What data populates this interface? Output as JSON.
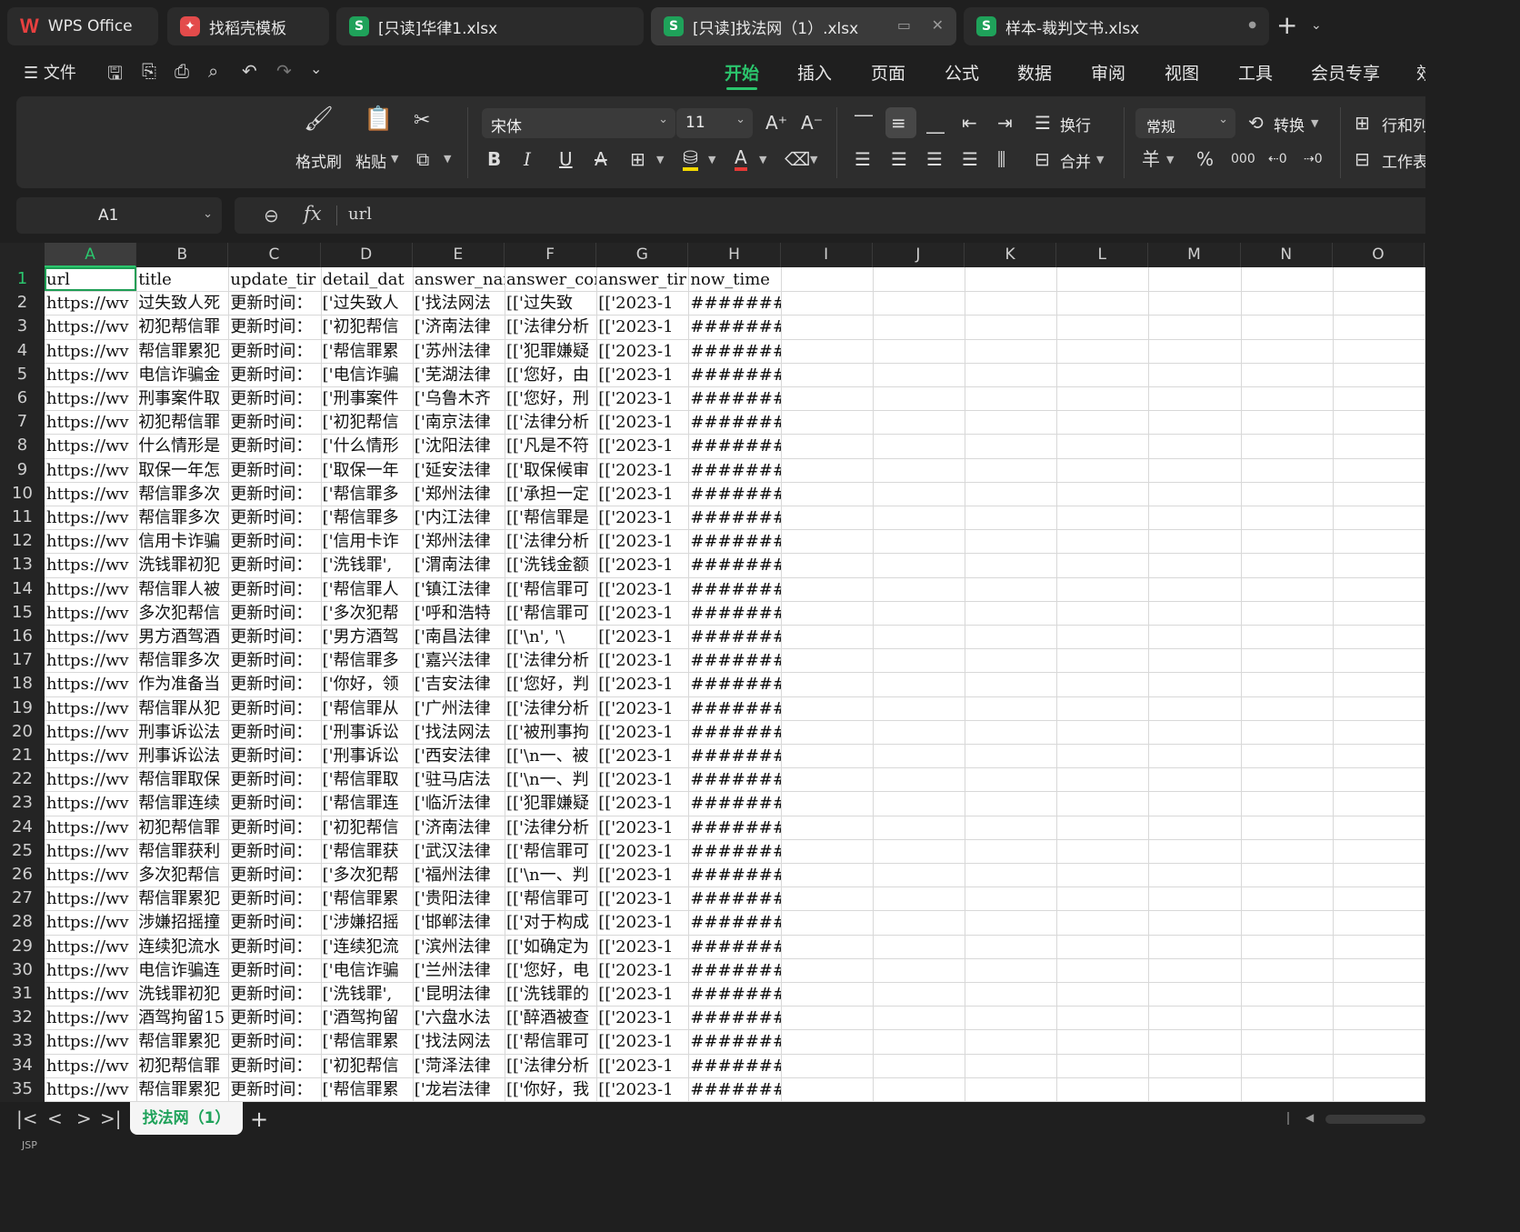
{
  "tabs": [
    {
      "label": "WPS Office",
      "icon": "wps-logo-icon"
    },
    {
      "label": "找稻壳模板",
      "icon": "docer-icon"
    },
    {
      "label": "[只读]华律1.xlsx",
      "icon": "sheet-file-icon"
    },
    {
      "label": "[只读]找法网（1）.xlsx",
      "icon": "sheet-file-icon",
      "active": true
    },
    {
      "label": "样本-裁判文书.xlsx",
      "icon": "sheet-file-icon"
    }
  ],
  "menu": {
    "file": "文件",
    "tabs": [
      "开始",
      "插入",
      "页面",
      "公式",
      "数据",
      "审阅",
      "视图",
      "工具",
      "会员专享",
      "效"
    ],
    "active_tab": "开始"
  },
  "ribbon": {
    "format_painter": "格式刷",
    "paste": "粘贴",
    "font_name": "宋体",
    "font_size": "11",
    "wrap": "换行",
    "merge": "合并",
    "number_format": "常规",
    "convert": "转换",
    "row_col": "行和列",
    "worksheet": "工作表",
    "currency_symbol": "羊",
    "percent_symbol": "%",
    "thousands_symbol": "000"
  },
  "formula_bar": {
    "name_box": "A1",
    "fx": "fx",
    "value": "url"
  },
  "columns": [
    "A",
    "B",
    "C",
    "D",
    "E",
    "F",
    "G",
    "H",
    "I",
    "J",
    "K",
    "L",
    "M",
    "N",
    "O"
  ],
  "selected_column": "A",
  "rows": [
    [
      "url",
      "title",
      "update_tir",
      "detail_dat",
      "answer_nar",
      "answer_cor",
      "answer_tir",
      "now_time"
    ],
    [
      "https://wv",
      "过失致人死",
      "更新时间：",
      "['过失致人",
      "['找法网法",
      "[['过失致",
      "[['2023-1",
      "#########"
    ],
    [
      "https://wv",
      "初犯帮信罪",
      "更新时间：",
      "['初犯帮信",
      "['济南法律",
      "[['法律分析",
      "[['2023-1",
      "#########"
    ],
    [
      "https://wv",
      "帮信罪累犯",
      "更新时间：",
      "['帮信罪累",
      "['苏州法律",
      "[['犯罪嫌疑",
      "[['2023-1",
      "#########"
    ],
    [
      "https://wv",
      "电信诈骗金",
      "更新时间：",
      "['电信诈骗",
      "['芜湖法律",
      "[['您好，由",
      "[['2023-1",
      "#########"
    ],
    [
      "https://wv",
      "刑事案件取",
      "更新时间：",
      "['刑事案件",
      "['乌鲁木齐",
      "[['您好，刑",
      "[['2023-1",
      "#########"
    ],
    [
      "https://wv",
      "初犯帮信罪",
      "更新时间：",
      "['初犯帮信",
      "['南京法律",
      "[['法律分析",
      "[['2023-1",
      "#########"
    ],
    [
      "https://wv",
      "什么情形是",
      "更新时间：",
      "['什么情形",
      "['沈阳法律",
      "[['凡是不符",
      "[['2023-1",
      "#########"
    ],
    [
      "https://wv",
      "取保一年怎",
      "更新时间：",
      "['取保一年",
      "['延安法律",
      "[['取保候审",
      "[['2023-1",
      "#########"
    ],
    [
      "https://wv",
      "帮信罪多次",
      "更新时间：",
      "['帮信罪多",
      "['郑州法律",
      "[['承担一定",
      "[['2023-1",
      "#########"
    ],
    [
      "https://wv",
      "帮信罪多次",
      "更新时间：",
      "['帮信罪多",
      "['内江法律",
      "[['帮信罪是",
      "[['2023-1",
      "#########"
    ],
    [
      "https://wv",
      "信用卡诈骗",
      "更新时间：",
      "['信用卡诈",
      "['郑州法律",
      "[['法律分析",
      "[['2023-1",
      "#########"
    ],
    [
      "https://wv",
      "洗钱罪初犯",
      "更新时间：",
      "['洗钱罪',",
      "['渭南法律",
      "[['洗钱金额",
      "[['2023-1",
      "#########"
    ],
    [
      "https://wv",
      "帮信罪人被",
      "更新时间：",
      "['帮信罪人",
      "['镇江法律",
      "[['帮信罪可",
      "[['2023-1",
      "#########"
    ],
    [
      "https://wv",
      "多次犯帮信",
      "更新时间：",
      "['多次犯帮",
      "['呼和浩特",
      "[['帮信罪可",
      "[['2023-1",
      "#########"
    ],
    [
      "https://wv",
      "男方酒驾酒",
      "更新时间：",
      "['男方酒驾",
      "['南昌法律",
      "[['\\n', '\\",
      "[['2023-1",
      "#########"
    ],
    [
      "https://wv",
      "帮信罪多次",
      "更新时间：",
      "['帮信罪多",
      "['嘉兴法律",
      "[['法律分析",
      "[['2023-1",
      "#########"
    ],
    [
      "https://wv",
      "作为准备当",
      "更新时间：",
      "['你好，领",
      "['吉安法律",
      "[['您好，判",
      "[['2023-1",
      "#########"
    ],
    [
      "https://wv",
      "帮信罪从犯",
      "更新时间：",
      "['帮信罪从",
      "['广州法律",
      "[['法律分析",
      "[['2023-1",
      "#########"
    ],
    [
      "https://wv",
      "刑事诉讼法",
      "更新时间：",
      "['刑事诉讼",
      "['找法网法",
      "[['被刑事拘",
      "[['2023-1",
      "#########"
    ],
    [
      "https://wv",
      "刑事诉讼法",
      "更新时间：",
      "['刑事诉讼",
      "['西安法律",
      "[['\\n一、被",
      "[['2023-1",
      "#########"
    ],
    [
      "https://wv",
      "帮信罪取保",
      "更新时间：",
      "['帮信罪取",
      "['驻马店法",
      "[['\\n一、判",
      "[['2023-1",
      "#########"
    ],
    [
      "https://wv",
      "帮信罪连续",
      "更新时间：",
      "['帮信罪连",
      "['临沂法律",
      "[['犯罪嫌疑",
      "[['2023-1",
      "#########"
    ],
    [
      "https://wv",
      "初犯帮信罪",
      "更新时间：",
      "['初犯帮信",
      "['济南法律",
      "[['法律分析",
      "[['2023-1",
      "#########"
    ],
    [
      "https://wv",
      "帮信罪获利",
      "更新时间：",
      "['帮信罪获",
      "['武汉法律",
      "[['帮信罪可",
      "[['2023-1",
      "#########"
    ],
    [
      "https://wv",
      "多次犯帮信",
      "更新时间：",
      "['多次犯帮",
      "['福州法律",
      "[['\\n一、判",
      "[['2023-1",
      "#########"
    ],
    [
      "https://wv",
      "帮信罪累犯",
      "更新时间：",
      "['帮信罪累",
      "['贵阳法律",
      "[['帮信罪可",
      "[['2023-1",
      "#########"
    ],
    [
      "https://wv",
      "涉嫌招摇撞",
      "更新时间：",
      "['涉嫌招摇",
      "['邯郸法律",
      "[['对于构成",
      "[['2023-1",
      "#########"
    ],
    [
      "https://wv",
      "连续犯流水",
      "更新时间：",
      "['连续犯流",
      "['滨州法律",
      "[['如确定为",
      "[['2023-1",
      "#########"
    ],
    [
      "https://wv",
      "电信诈骗连",
      "更新时间：",
      "['电信诈骗",
      "['兰州法律",
      "[['您好，电",
      "[['2023-1",
      "#########"
    ],
    [
      "https://wv",
      "洗钱罪初犯",
      "更新时间：",
      "['洗钱罪',",
      "['昆明法律",
      "[['洗钱罪的",
      "[['2023-1",
      "#########"
    ],
    [
      "https://wv",
      "酒驾拘留15",
      "更新时间：",
      "['酒驾拘留",
      "['六盘水法",
      "[['醉酒被查",
      "[['2023-1",
      "#########"
    ],
    [
      "https://wv",
      "帮信罪累犯",
      "更新时间：",
      "['帮信罪累",
      "['找法网法",
      "[['帮信罪可",
      "[['2023-1",
      "#########"
    ],
    [
      "https://wv",
      "初犯帮信罪",
      "更新时间：",
      "['初犯帮信",
      "['菏泽法律",
      "[['法律分析",
      "[['2023-1",
      "#########"
    ],
    [
      "https://wv",
      "帮信罪累犯",
      "更新时间：",
      "['帮信罪累",
      "['龙岩法律",
      "[['你好，我",
      "[['2023-1",
      "#########"
    ]
  ],
  "sheet_tab": "找法网（1）",
  "colors": {
    "accent": "#2bc56d",
    "sheet_icon": "#1fa25a",
    "wps_red": "#e84040"
  }
}
